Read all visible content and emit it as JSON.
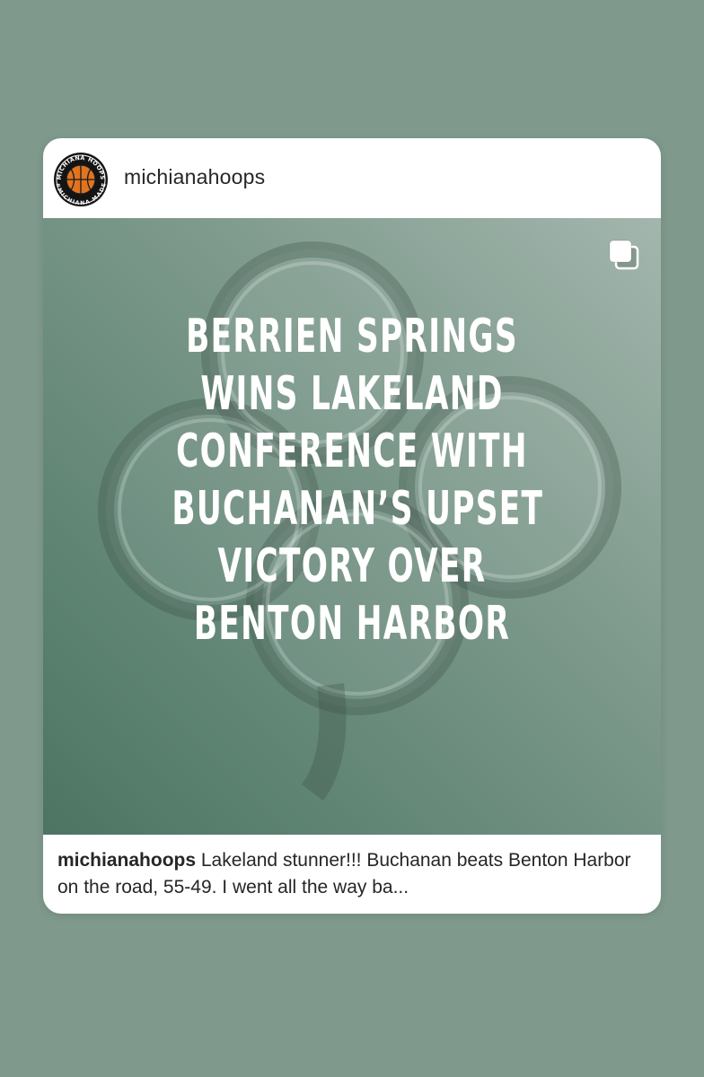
{
  "post": {
    "username": "michianahoops",
    "avatar": {
      "icon": "basketball-logo-icon",
      "ring_text_top": "MICHIANA HOOPS",
      "ring_text_bottom": "#MICHIANA MADE"
    },
    "headline_lines": [
      "BERRIEN SPRINGS",
      "WINS LAKELAND",
      "CONFERENCE WITH",
      "BUCHANAN’S UPSET",
      "VICTORY OVER",
      "BENTON HARBOR"
    ],
    "carousel_icon": "multiple-images-icon",
    "background_graphic": "shamrock-icon",
    "caption": {
      "username": "michianahoops",
      "text": "Lakeland stunner!!! Buchanan beats Benton Harbor on the road, 55-49. I went all the way ba..."
    }
  },
  "colors": {
    "page_background": "#7f9a8d",
    "card_background": "#ffffff",
    "image_gradient_dark": "#4d7463",
    "image_gradient_light": "#a3b6ad",
    "headline_text": "#ffffff",
    "basketball": "#e0741f"
  }
}
